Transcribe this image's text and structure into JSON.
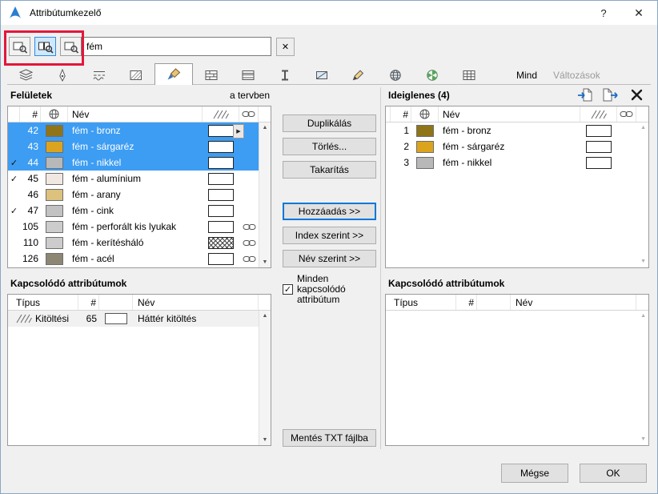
{
  "window": {
    "title": "Attribútumkezelő",
    "help_label": "?",
    "close_label": "✕"
  },
  "toolbar": {
    "filter_buttons": [
      {
        "name": "show-selected-type",
        "icon": "filter-doc",
        "selected": false
      },
      {
        "name": "show-used-types",
        "icon": "filter-docs",
        "selected": true
      },
      {
        "name": "show-all-types",
        "icon": "filter-doc",
        "selected": false
      }
    ],
    "search_value": "fém",
    "clear_label": "✕"
  },
  "tabs": {
    "items": [
      {
        "name": "layers",
        "selected": false
      },
      {
        "name": "pens",
        "selected": false
      },
      {
        "name": "line-types",
        "selected": false
      },
      {
        "name": "fill-types",
        "selected": false
      },
      {
        "name": "surfaces",
        "selected": true
      },
      {
        "name": "building-materials",
        "selected": false
      },
      {
        "name": "composites",
        "selected": false
      },
      {
        "name": "profiles",
        "selected": false
      },
      {
        "name": "zone-categories",
        "selected": false
      },
      {
        "name": "markup-styles",
        "selected": false
      },
      {
        "name": "cities",
        "selected": false
      },
      {
        "name": "operation-profiles",
        "selected": false
      },
      {
        "name": "mep-systems",
        "selected": false
      }
    ],
    "all_label": "Mind",
    "changes_label": "Változások"
  },
  "surfaces": {
    "title": "Felületek",
    "scope_label": "a tervben",
    "columns": {
      "num": "#",
      "name": "Név"
    },
    "rows": [
      {
        "checked": false,
        "num": "42",
        "color": "#8f7418",
        "name": "fém - bronz",
        "selected": true,
        "popup": true,
        "hatch": false,
        "linked": false
      },
      {
        "checked": false,
        "num": "43",
        "color": "#dca41e",
        "name": "fém - sárgaréz",
        "selected": true,
        "popup": false,
        "hatch": false,
        "linked": false
      },
      {
        "checked": true,
        "num": "44",
        "color": "#b8b8b8",
        "name": "fém - nikkel",
        "selected": true,
        "popup": false,
        "hatch": false,
        "linked": false
      },
      {
        "checked": true,
        "num": "45",
        "color": "#f2e8e2",
        "name": "fém - alumínium",
        "selected": false,
        "popup": false,
        "hatch": false,
        "linked": false
      },
      {
        "checked": false,
        "num": "46",
        "color": "#dcc27c",
        "name": "fém - arany",
        "selected": false,
        "popup": false,
        "hatch": false,
        "linked": false
      },
      {
        "checked": true,
        "num": "47",
        "color": "#c2c2c2",
        "name": "fém - cink",
        "selected": false,
        "popup": false,
        "hatch": false,
        "linked": false
      },
      {
        "checked": false,
        "num": "105",
        "color": "#cccccc",
        "name": "fém - perforált kis lyukak",
        "selected": false,
        "popup": false,
        "hatch": false,
        "linked": true
      },
      {
        "checked": false,
        "num": "110",
        "color": "#cccccc",
        "name": "fém - kerítésháló",
        "selected": false,
        "popup": false,
        "hatch": true,
        "linked": true
      },
      {
        "checked": false,
        "num": "126",
        "color": "#8d8673",
        "name": "fém - acél",
        "selected": false,
        "popup": false,
        "hatch": false,
        "linked": true
      }
    ]
  },
  "actions": {
    "duplicate": "Duplikálás",
    "delete": "Törlés...",
    "purge": "Takarítás",
    "append": "Hozzáadás >>",
    "overwrite_by_index": "Index szerint >>",
    "overwrite_by_name": "Név szerint >>",
    "all_related_label": "Minden kapcsolódó attribútum",
    "all_related_checked": true,
    "save_txt": "Mentés TXT fájlba"
  },
  "temporary": {
    "title": "Ideiglenes (4)",
    "columns": {
      "num": "#",
      "name": "Név"
    },
    "rows": [
      {
        "num": "1",
        "color": "#8f7418",
        "name": "fém - bronz"
      },
      {
        "num": "2",
        "color": "#dca41e",
        "name": "fém - sárgaréz"
      },
      {
        "num": "3",
        "color": "#b8b8b8",
        "name": "fém - nikkel"
      }
    ]
  },
  "related_plan": {
    "title": "Kapcsolódó attribútumok",
    "columns": {
      "type": "Típus",
      "num": "#",
      "name": "Név"
    },
    "rows": [
      {
        "type": "Kitöltési",
        "num": "65",
        "name": "Háttér kitöltés"
      }
    ]
  },
  "related_temp": {
    "title": "Kapcsolódó attribútumok",
    "columns": {
      "type": "Típus",
      "num": "#",
      "name": "Név"
    },
    "rows": []
  },
  "footer": {
    "cancel": "Mégse",
    "ok": "OK"
  },
  "colors": {
    "selection": "#3d9df3",
    "accent": "#0078d7",
    "annotation": "#e3173b"
  }
}
